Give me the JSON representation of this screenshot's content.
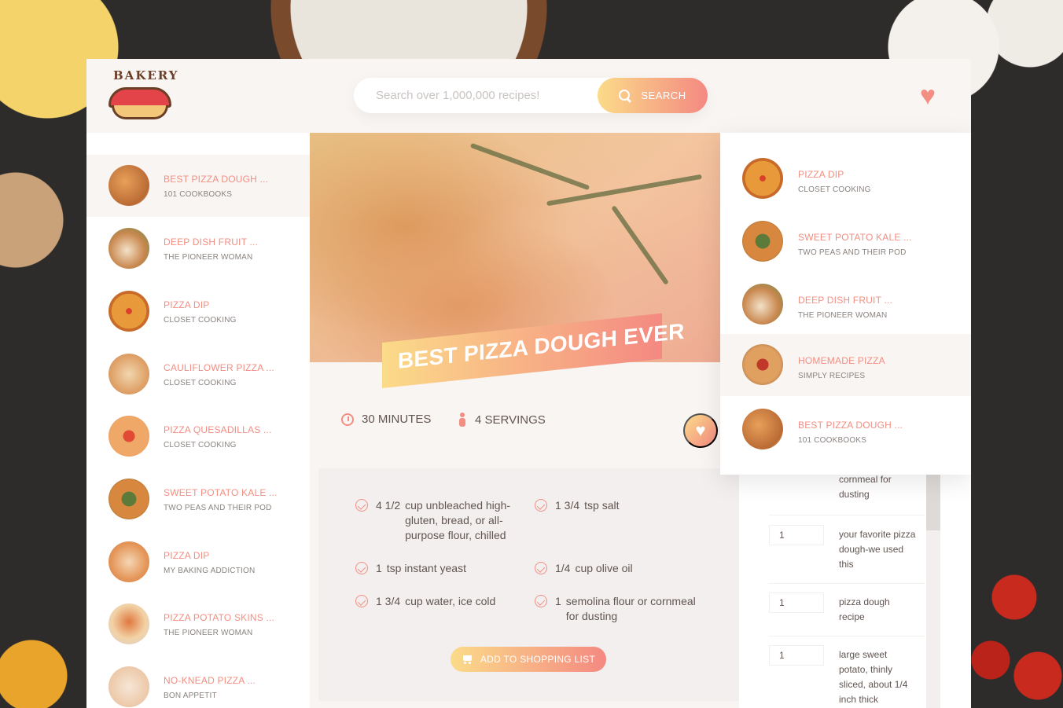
{
  "header": {
    "logo_text": "BAKERY",
    "search_placeholder": "Search over 1,000,000 recipes!",
    "search_button": "SEARCH"
  },
  "results": [
    {
      "title": "BEST PIZZA DOUGH ...",
      "publisher": "101 COOKBOOKS",
      "active": true
    },
    {
      "title": "DEEP DISH FRUIT ...",
      "publisher": "THE PIONEER WOMAN"
    },
    {
      "title": "PIZZA DIP",
      "publisher": "CLOSET COOKING"
    },
    {
      "title": "CAULIFLOWER PIZZA ...",
      "publisher": "CLOSET COOKING"
    },
    {
      "title": "PIZZA QUESADILLAS ...",
      "publisher": "CLOSET COOKING"
    },
    {
      "title": "SWEET POTATO KALE ...",
      "publisher": "TWO PEAS AND THEIR POD"
    },
    {
      "title": "PIZZA DIP",
      "publisher": "MY BAKING ADDICTION"
    },
    {
      "title": "PIZZA POTATO SKINS ...",
      "publisher": "THE PIONEER WOMAN"
    },
    {
      "title": "NO-KNEAD PIZZA ...",
      "publisher": "BON APPETIT"
    }
  ],
  "recipe": {
    "title": "BEST PIZZA DOUGH EVER",
    "time": "30 MINUTES",
    "servings": "4 SERVINGS",
    "ingredients": [
      {
        "qty": "4 1/2",
        "text": "cup unbleached high-gluten, bread, or all-purpose flour, chilled"
      },
      {
        "qty": "1 3/4",
        "text": "tsp salt"
      },
      {
        "qty": "1",
        "text": "tsp instant yeast"
      },
      {
        "qty": "1/4",
        "text": "cup olive oil"
      },
      {
        "qty": "1 3/4",
        "text": "cup water, ice cold"
      },
      {
        "qty": "1",
        "text": "semolina flour or cornmeal for dusting"
      }
    ],
    "add_to_list": "ADD TO SHOPPING LIST"
  },
  "likes": [
    {
      "title": "PIZZA DIP",
      "publisher": "CLOSET COOKING"
    },
    {
      "title": "SWEET POTATO KALE ...",
      "publisher": "TWO PEAS AND THEIR POD"
    },
    {
      "title": "DEEP DISH FRUIT ...",
      "publisher": "THE PIONEER WOMAN"
    },
    {
      "title": "HOMEMADE PIZZA",
      "publisher": "SIMPLY RECIPES",
      "active": true
    },
    {
      "title": "BEST PIZZA DOUGH ...",
      "publisher": "101 COOKBOOKS"
    }
  ],
  "shopping_list": [
    {
      "qty": "",
      "text": "cornmeal for dusting"
    },
    {
      "qty": "1",
      "text": "your favorite pizza dough-we used this"
    },
    {
      "qty": "1",
      "text": "pizza dough recipe"
    },
    {
      "qty": "1",
      "text": "large sweet potato, thinly sliced, about 1/4 inch thick"
    }
  ],
  "colors": {
    "accent_start": "#fbdb89",
    "accent_end": "#f48982",
    "text": "#615551",
    "background": "#f9f5f3"
  }
}
